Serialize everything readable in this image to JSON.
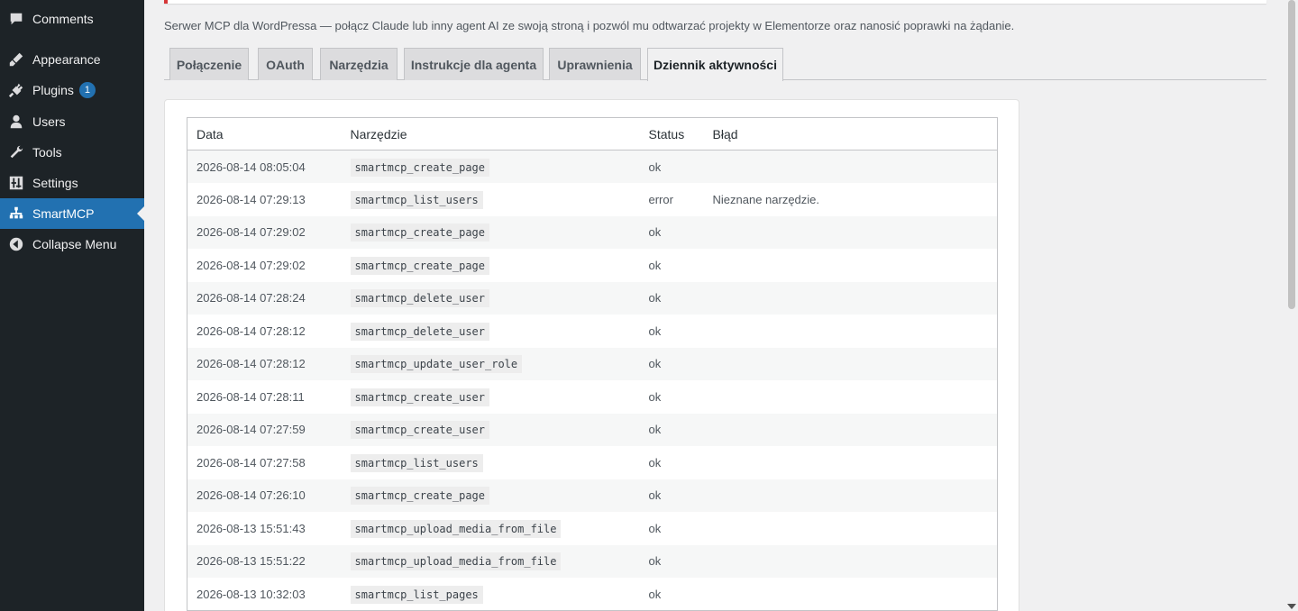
{
  "sidebar": {
    "items": [
      {
        "label": "Comments",
        "icon": "comments-icon"
      },
      {
        "label": "Appearance",
        "icon": "appearance-icon"
      },
      {
        "label": "Plugins",
        "icon": "plugins-icon",
        "badge": "1"
      },
      {
        "label": "Users",
        "icon": "users-icon"
      },
      {
        "label": "Tools",
        "icon": "tools-icon"
      },
      {
        "label": "Settings",
        "icon": "settings-icon"
      },
      {
        "label": "SmartMCP",
        "icon": "sitemap-icon",
        "current": true
      },
      {
        "label": "Collapse Menu",
        "icon": "collapse-icon"
      }
    ]
  },
  "intro": "Serwer MCP dla WordPressa — połącz Claude lub inny agent AI ze swoją stroną i pozwól mu odtwarzać projekty w Elementorze oraz nanosić poprawki na żądanie.",
  "tabs": [
    {
      "label": "Połączenie"
    },
    {
      "label": "OAuth"
    },
    {
      "label": "Narzędzia"
    },
    {
      "label": "Instrukcje dla agenta"
    },
    {
      "label": "Uprawnienia"
    },
    {
      "label": "Dziennik aktywności",
      "active": true
    }
  ],
  "table": {
    "headers": {
      "date": "Data",
      "tool": "Narzędzie",
      "status": "Status",
      "error": "Błąd"
    },
    "rows": [
      {
        "date": "2026-08-14 08:05:04",
        "tool": "smartmcp_create_page",
        "status": "ok",
        "error": ""
      },
      {
        "date": "2026-08-14 07:29:13",
        "tool": "smartmcp_list_users",
        "status": "error",
        "error": "Nieznane narzędzie."
      },
      {
        "date": "2026-08-14 07:29:02",
        "tool": "smartmcp_create_page",
        "status": "ok",
        "error": ""
      },
      {
        "date": "2026-08-14 07:29:02",
        "tool": "smartmcp_create_page",
        "status": "ok",
        "error": ""
      },
      {
        "date": "2026-08-14 07:28:24",
        "tool": "smartmcp_delete_user",
        "status": "ok",
        "error": ""
      },
      {
        "date": "2026-08-14 07:28:12",
        "tool": "smartmcp_delete_user",
        "status": "ok",
        "error": ""
      },
      {
        "date": "2026-08-14 07:28:12",
        "tool": "smartmcp_update_user_role",
        "status": "ok",
        "error": ""
      },
      {
        "date": "2026-08-14 07:28:11",
        "tool": "smartmcp_create_user",
        "status": "ok",
        "error": ""
      },
      {
        "date": "2026-08-14 07:27:59",
        "tool": "smartmcp_create_user",
        "status": "ok",
        "error": ""
      },
      {
        "date": "2026-08-14 07:27:58",
        "tool": "smartmcp_list_users",
        "status": "ok",
        "error": ""
      },
      {
        "date": "2026-08-14 07:26:10",
        "tool": "smartmcp_create_page",
        "status": "ok",
        "error": ""
      },
      {
        "date": "2026-08-13 15:51:43",
        "tool": "smartmcp_upload_media_from_file",
        "status": "ok",
        "error": ""
      },
      {
        "date": "2026-08-13 15:51:22",
        "tool": "smartmcp_upload_media_from_file",
        "status": "ok",
        "error": ""
      },
      {
        "date": "2026-08-13 10:32:03",
        "tool": "smartmcp_list_pages",
        "status": "ok",
        "error": ""
      }
    ]
  },
  "colors": {
    "sidebar_bg": "#1d2327",
    "accent": "#2271b1",
    "ok": "#2e7d32",
    "error": "#b32d2e",
    "notice_border": "#d63638"
  }
}
